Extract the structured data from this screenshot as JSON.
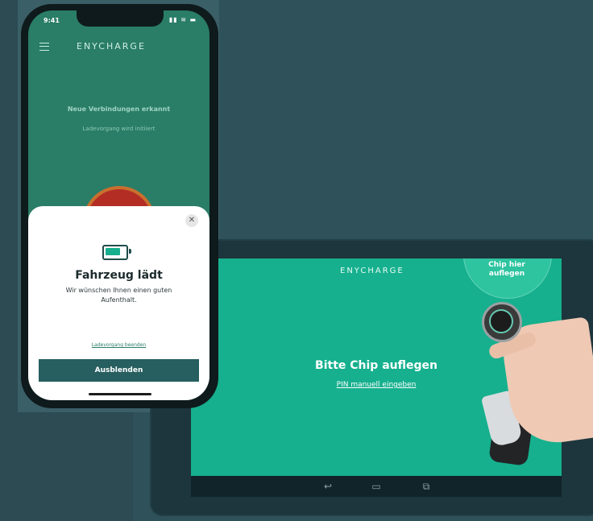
{
  "colors": {
    "background": "#2f5159",
    "brand_teal": "#16b08e",
    "phone_screen": "#2a7d67",
    "button_dark": "#275e5f"
  },
  "phone": {
    "status_time": "9:41",
    "status_icons": "signal-wifi-battery",
    "menu_icon": "hamburger-menu-icon",
    "logo": "ENYCHARGE",
    "status_title": "Neue Verbindungen erkannt",
    "status_subtitle": "Ladevorgang wird initiiert",
    "sheet": {
      "close_icon": "close-icon",
      "battery_icon": "battery-charging-icon",
      "title": "Fahrzeug lädt",
      "body": "Wir wünschen Ihnen einen guten Aufenthalt.",
      "link": "Ladevorgang beenden",
      "button": "Ausblenden"
    }
  },
  "tablet": {
    "logo": "ENYCHARGE",
    "chip_label": "Chip hier auflegen",
    "heading": "Bitte Chip auflegen",
    "pin_link": "PIN manuell eingeben",
    "nav": {
      "back_icon": "back-icon",
      "home_icon": "home-icon",
      "recents_icon": "recents-icon"
    }
  }
}
